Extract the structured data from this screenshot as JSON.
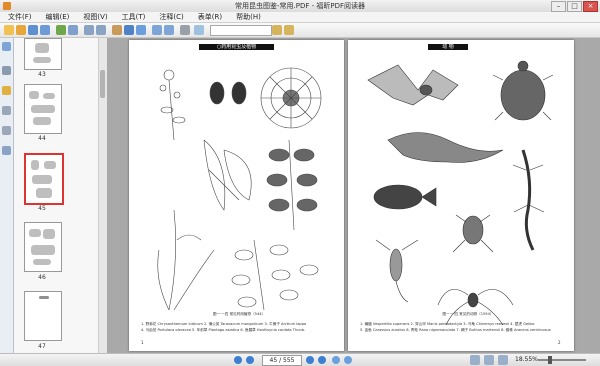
{
  "window": {
    "title": "常用昆虫图鉴-常用.PDF - 福昕PDF阅读器",
    "controls": [
      "–",
      "□",
      "×"
    ]
  },
  "menubar": {
    "items": [
      "文件(F)",
      "编辑(E)",
      "视图(V)",
      "工具(T)",
      "注释(C)",
      "表单(R)",
      "帮助(H)"
    ]
  },
  "toolbar": {
    "search_placeholder": ""
  },
  "thumbnails": [
    {
      "label": "43",
      "selected": false
    },
    {
      "label": "44",
      "selected": false
    },
    {
      "label": "45",
      "selected": true
    },
    {
      "label": "46",
      "selected": false
    },
    {
      "label": "47",
      "selected": false
    }
  ],
  "pages": {
    "left": {
      "header": "○药用昆虫及植物",
      "caption_title": "图一·一四  常见药用植物（544）",
      "caption_lines": [
        "1. 野菊花 Chrysanthemum indicum   2. 蒲公英 Taraxacum mongolicum   3. 牛蒡子 Arctium lappa",
        "4. 马齿苋 Portulaca oleracea   5. 车前草 Plantago asiatica   6. 鱼腥草 Houttuynia cordata Thunb."
      ],
      "page_number": "1"
    },
    "right": {
      "header": "动  物",
      "caption_title": "图一·一四  常见的动物（1594）",
      "caption_lines": [
        "1. 蝙蝠 Vespertilio superans   2. 穿山甲 Manis pentadactyla   3. 乌龟 Chinemys reevesii   4. 壁虎 Gekko",
        "5. 金鱼 Carassius auratus   6. 青蛙 Rana nigromaculata   7. 蝎子 Buthus martensii   8. 蜘蛛 Araneus ventricosus"
      ],
      "page_number": "2"
    }
  },
  "statusbar": {
    "page_display": "45 / 555",
    "zoom": "18.55%"
  },
  "colors": {
    "accent": "#3d7fd1",
    "selected_thumb_border": "#dd3333",
    "doc_background": "#a9a9a9"
  }
}
